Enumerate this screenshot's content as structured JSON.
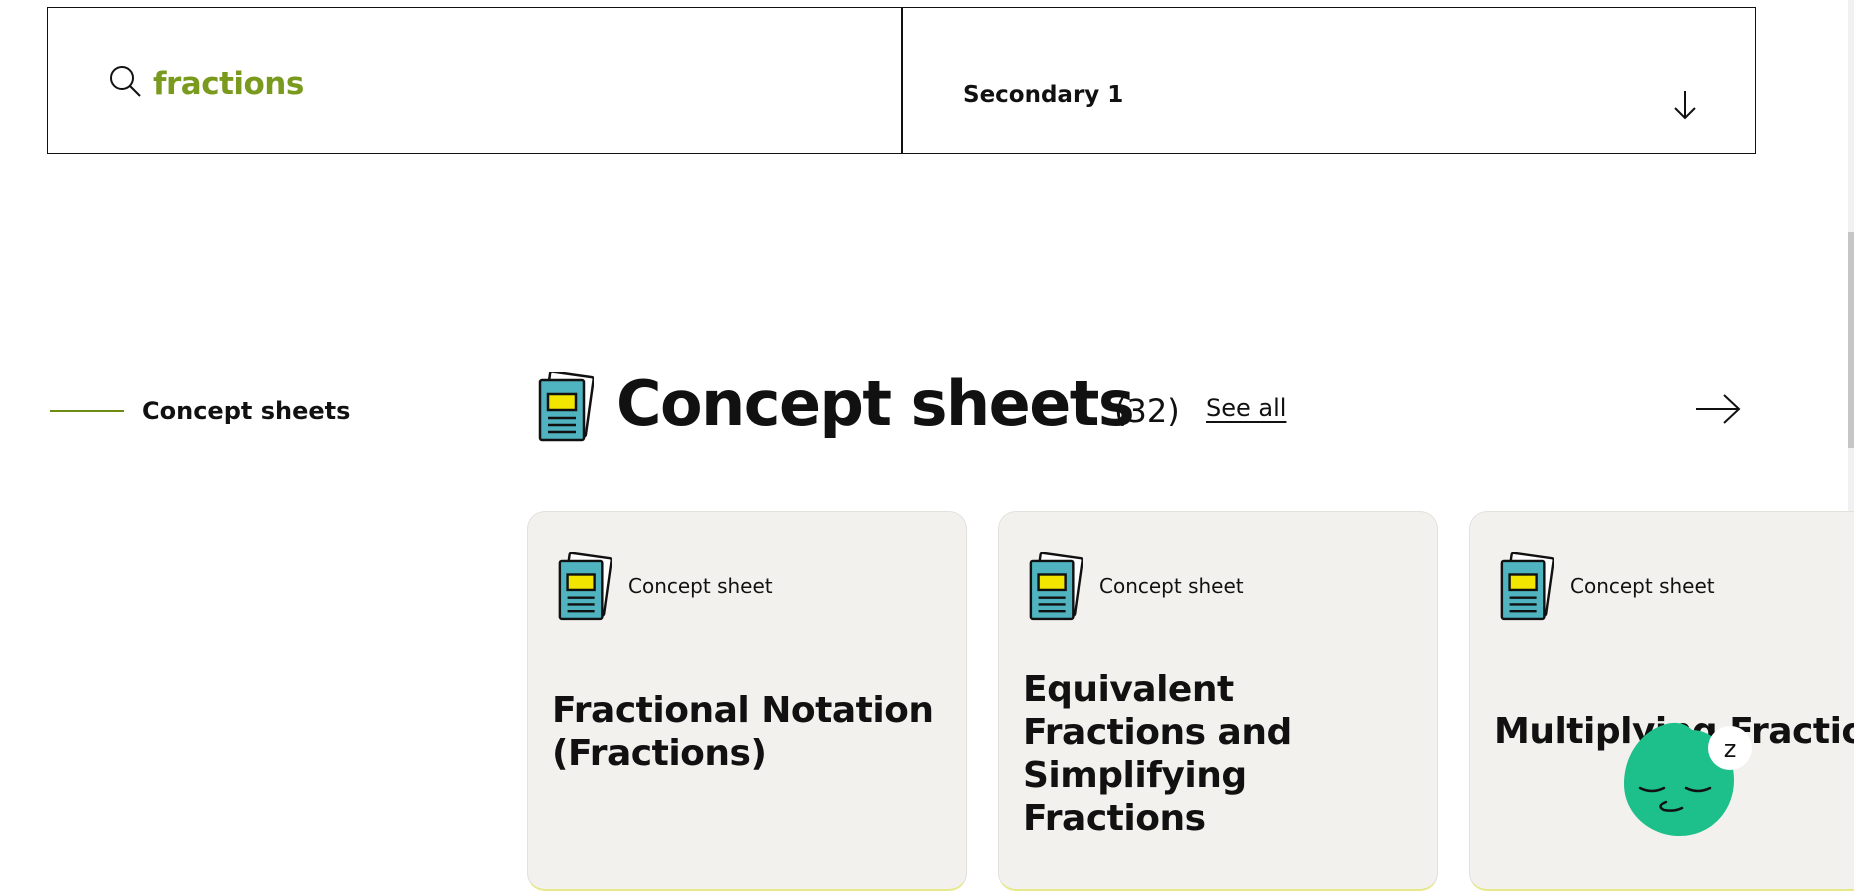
{
  "search": {
    "query": "fractions",
    "level": "Secondary 1"
  },
  "sidebar": {
    "items": [
      {
        "label": "Concept sheets",
        "active": true
      }
    ]
  },
  "section": {
    "title": "Concept sheets",
    "count": "(32)",
    "see_all": "See all"
  },
  "cards": [
    {
      "type": "Concept sheet",
      "title": "Fractional Notation (Fractions)"
    },
    {
      "type": "Concept sheet",
      "title": "Equivalent Fractions and Simplifying Fractions"
    },
    {
      "type": "Concept sheet",
      "title": "Multiplying Fractions"
    }
  ],
  "colors": {
    "accent": "#7a9a1e",
    "card_bg": "#f2f1ee",
    "icon_teal": "#4fb3c0",
    "icon_yellow": "#f2e600",
    "mascot_green": "#1dbf8a"
  },
  "icons": {
    "search": "search-icon",
    "dropdown": "arrow-down-icon",
    "next": "arrow-right-icon",
    "sheet": "concept-sheet-icon",
    "mascot": "sleeping-mascot-icon"
  }
}
